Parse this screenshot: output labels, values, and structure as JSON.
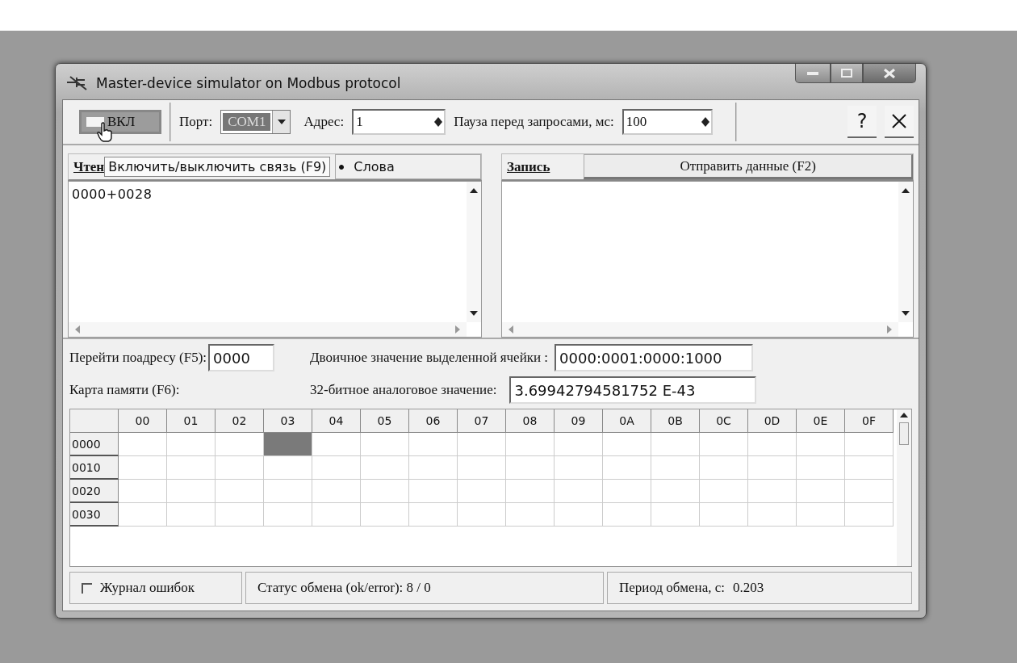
{
  "window": {
    "title": "Master-device simulator on Modbus protocol"
  },
  "toolbar": {
    "connect_button": {
      "label": "ВКЛ"
    },
    "port": {
      "label": "Порт:",
      "value": "COM1"
    },
    "address": {
      "label": "Адрес:",
      "value": "1"
    },
    "pause": {
      "label": "Пауза перед запросами, мс:",
      "value": "100"
    },
    "help_button": "?"
  },
  "read_panel": {
    "title": "Чтен",
    "tooltip": "Включить/выключить связь (F9)",
    "radio": {
      "label": "Слова",
      "selected": true
    },
    "content": "0000+0028"
  },
  "write_panel": {
    "title": "Запись",
    "send_button": "Отправить данные (F2)"
  },
  "goto": {
    "label": "Перейти поадресу (F5):",
    "value": "0000"
  },
  "binary": {
    "label": "Двоичное значение выделенной ячейки :",
    "value": "0000:0001:0000:1000"
  },
  "memory_map": {
    "label": "Карта памяти (F6):"
  },
  "analog": {
    "label": "32-битное аналоговое значение:",
    "value": "3.69942794581752 E-43"
  },
  "grid": {
    "columns": [
      "00",
      "01",
      "02",
      "03",
      "04",
      "05",
      "06",
      "07",
      "08",
      "09",
      "0A",
      "0B",
      "0C",
      "0D",
      "0E",
      "0F"
    ],
    "rows": [
      {
        "address": "0000",
        "cells": [
          {
            "selected": false
          },
          {
            "selected": false
          },
          {
            "selected": false
          },
          {
            "selected": true
          },
          {
            "selected": false
          },
          {
            "selected": false
          },
          {
            "selected": false
          },
          {
            "selected": false
          },
          {
            "selected": false
          },
          {
            "selected": false
          },
          {
            "selected": false
          },
          {
            "selected": false
          },
          {
            "selected": false
          },
          {
            "selected": false
          },
          {
            "selected": false
          },
          {
            "selected": false
          }
        ]
      },
      {
        "address": "0010",
        "cells": [
          {
            "selected": false
          },
          {
            "selected": false
          },
          {
            "selected": false
          },
          {
            "selected": false
          },
          {
            "selected": false
          },
          {
            "selected": false
          },
          {
            "selected": false
          },
          {
            "selected": false
          },
          {
            "selected": false
          },
          {
            "selected": false
          },
          {
            "selected": false
          },
          {
            "selected": false
          },
          {
            "selected": false
          },
          {
            "selected": false
          },
          {
            "selected": false
          },
          {
            "selected": false
          }
        ]
      },
      {
        "address": "0020",
        "cells": [
          {
            "selected": false
          },
          {
            "selected": false
          },
          {
            "selected": false
          },
          {
            "selected": false
          },
          {
            "selected": false
          },
          {
            "selected": false
          },
          {
            "selected": false
          },
          {
            "selected": false
          },
          {
            "selected": false
          },
          {
            "selected": false
          },
          {
            "selected": false
          },
          {
            "selected": false
          },
          {
            "selected": false
          },
          {
            "selected": false
          },
          {
            "selected": false
          },
          {
            "selected": false
          }
        ]
      },
      {
        "address": "0030",
        "cells": [
          {
            "selected": false
          },
          {
            "selected": false
          },
          {
            "selected": false
          },
          {
            "selected": false
          },
          {
            "selected": false
          },
          {
            "selected": false
          },
          {
            "selected": false
          },
          {
            "selected": false
          },
          {
            "selected": false
          },
          {
            "selected": false
          },
          {
            "selected": false
          },
          {
            "selected": false
          },
          {
            "selected": false
          },
          {
            "selected": false
          },
          {
            "selected": false
          },
          {
            "selected": false
          }
        ]
      }
    ]
  },
  "status_bar": {
    "error_log": {
      "label": "Журнал ошибок",
      "checked": false
    },
    "exchange_status": "Статус обмена (ok/error): 8 / 0",
    "period_label": "Период обмена, с:",
    "period_value": "0.203"
  }
}
